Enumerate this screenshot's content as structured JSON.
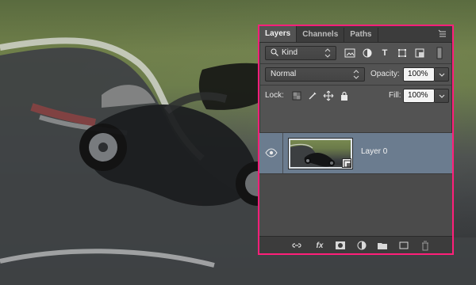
{
  "panel": {
    "tabs": [
      {
        "label": "Layers",
        "active": true
      },
      {
        "label": "Channels",
        "active": false
      },
      {
        "label": "Paths",
        "active": false
      }
    ],
    "filter": {
      "kind_label": "Kind",
      "icons": [
        "image-filter-icon",
        "adjustment-filter-icon",
        "type-filter-icon",
        "shape-filter-icon",
        "smart-object-filter-icon",
        "filter-toggle-icon"
      ]
    },
    "blend": {
      "mode": "Normal",
      "opacity_label": "Opacity:",
      "opacity_value": "100%"
    },
    "lock": {
      "label": "Lock:",
      "fill_label": "Fill:",
      "fill_value": "100%",
      "icons": [
        "lock-transparent-pixels-icon",
        "lock-image-pixels-icon",
        "lock-position-icon",
        "lock-all-icon"
      ]
    },
    "layers": [
      {
        "name": "Layer 0",
        "selected": true,
        "visible": true
      }
    ],
    "footer": {
      "icons": [
        "link-layers-icon",
        "fx-icon",
        "add-mask-icon",
        "adjustment-layer-icon",
        "new-group-icon",
        "new-layer-icon",
        "trash-icon"
      ],
      "fx_text": "fx"
    }
  },
  "colors": {
    "highlight_border": "#ff1f7a",
    "panel_bg": "#535353",
    "selected_row": "#6b7c8f"
  }
}
